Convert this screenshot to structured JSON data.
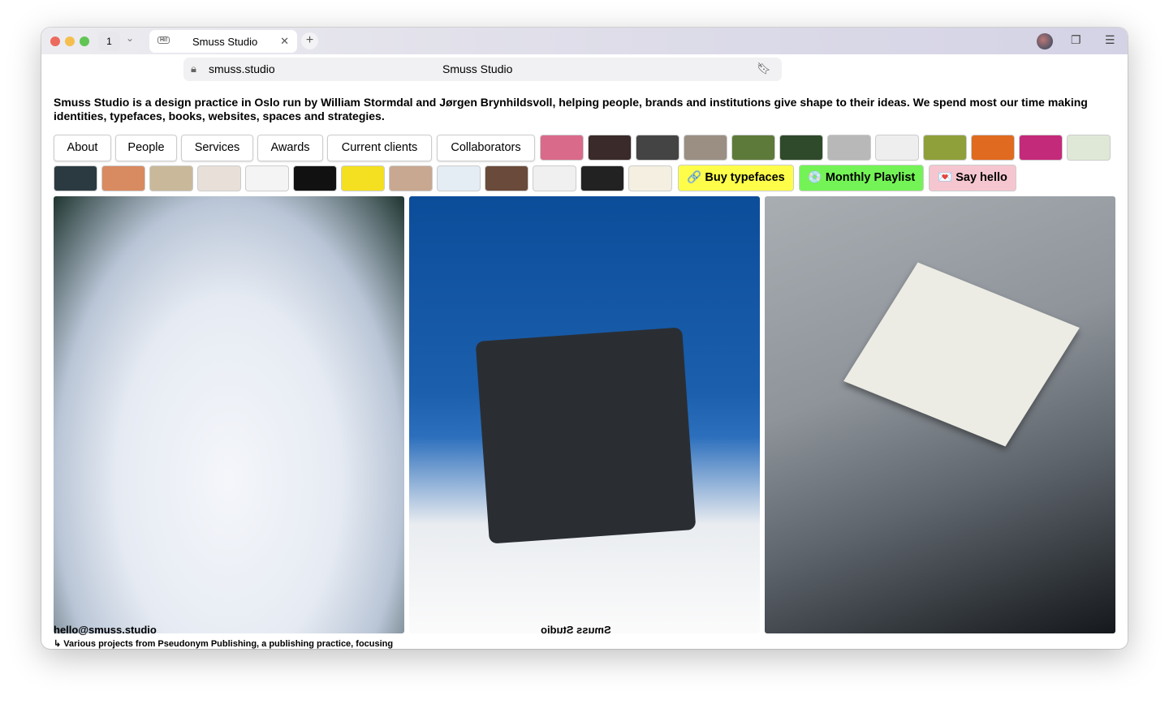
{
  "browser": {
    "tab_count": "1",
    "tab_title": "Smuss Studio",
    "favicon": "Hi!",
    "url": "smuss.studio",
    "page_title": "Smuss Studio"
  },
  "intro": "Smuss Studio is a design practice in Oslo run by William Stormdal and Jørgen Brynhildsvoll, helping people, brands and institutions give shape to their ideas. We spend most our time making identities, typefaces, books, websites, spaces and strategies.",
  "nav": [
    "About",
    "People",
    "Services",
    "Awards",
    "Current clients",
    "Collaborators"
  ],
  "cta": {
    "buy": "Buy typefaces",
    "buy_icon": "🔗",
    "playlist": "Monthly Playlist",
    "playlist_icon": "💿",
    "hello": "Say hello",
    "hello_icon": "💌",
    "colors": {
      "buy": "#fdfd4a",
      "playlist": "#74f356",
      "hello": "#f5c6cf"
    }
  },
  "footer": {
    "email": "hello@smuss.studio",
    "mirrored": "Smuss Studio",
    "caption": "↳ Various projects from Pseudonym Publishing, a publishing practice, focusing"
  }
}
